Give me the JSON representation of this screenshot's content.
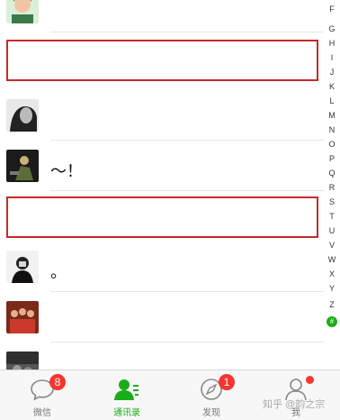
{
  "contacts": [
    {
      "name": "",
      "avatar": "avatar-illustrated-man"
    },
    {
      "name": "",
      "avatar": "avatar-hidden"
    },
    {
      "name": "",
      "avatar": "avatar-bw-woman"
    },
    {
      "name": "～！",
      "avatar": "avatar-dark-sports"
    },
    {
      "name": "",
      "avatar": "avatar-hidden"
    },
    {
      "name": "。",
      "avatar": "avatar-bw-person"
    },
    {
      "name": "",
      "avatar": "avatar-red-group"
    },
    {
      "name": "",
      "avatar": "avatar-street"
    }
  ],
  "index_letters": [
    "F",
    "G",
    "H",
    "I",
    "J",
    "K",
    "L",
    "M",
    "N",
    "O",
    "P",
    "Q",
    "R",
    "S",
    "T",
    "U",
    "V",
    "W",
    "X",
    "Y",
    "Z",
    "#"
  ],
  "tabs": [
    {
      "label": "微信",
      "icon": "chat-bubble-icon",
      "badge": "8"
    },
    {
      "label": "通讯录",
      "icon": "contacts-icon",
      "active": true
    },
    {
      "label": "发现",
      "icon": "compass-icon",
      "badge": "1"
    },
    {
      "label": "我",
      "icon": "person-icon",
      "dot": true
    }
  ],
  "watermark": "知乎 @韵之宗",
  "colors": {
    "accent": "#1aad19",
    "badge": "#f43530",
    "highlight_box": "#c62b2b"
  }
}
